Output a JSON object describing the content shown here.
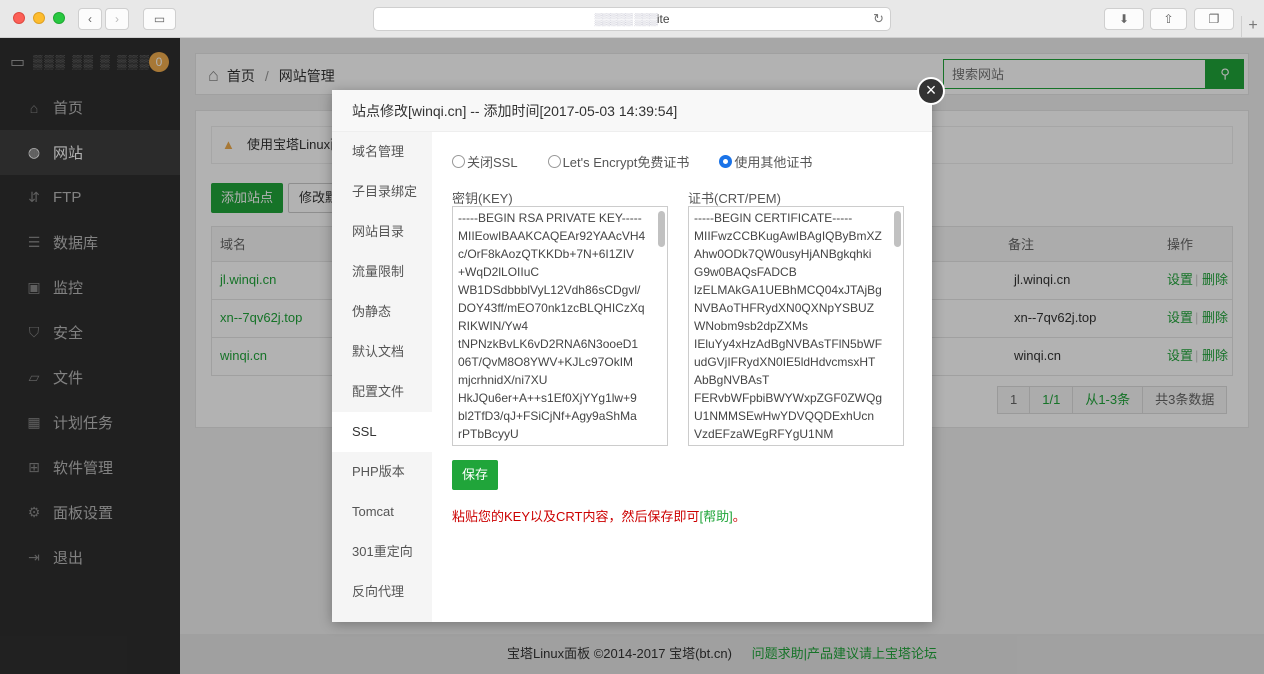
{
  "browser": {
    "url": "ite",
    "url_blur": "▒▒▒▒▒  ▒▒▒"
  },
  "sidebar": {
    "host": "▒▒▒ ▒▒ ▒ ▒▒▒",
    "badge": "0",
    "items": [
      {
        "label": "首页",
        "icon": "home-icon"
      },
      {
        "label": "网站",
        "icon": "globe-icon"
      },
      {
        "label": "FTP",
        "icon": "ftp-icon"
      },
      {
        "label": "数据库",
        "icon": "database-icon"
      },
      {
        "label": "监控",
        "icon": "monitor-icon"
      },
      {
        "label": "安全",
        "icon": "shield-icon"
      },
      {
        "label": "文件",
        "icon": "folder-icon"
      },
      {
        "label": "计划任务",
        "icon": "calendar-icon"
      },
      {
        "label": "软件管理",
        "icon": "apps-icon"
      },
      {
        "label": "面板设置",
        "icon": "gear-icon"
      },
      {
        "label": "退出",
        "icon": "logout-icon"
      }
    ]
  },
  "header": {
    "breadcrumb_home": "首页",
    "breadcrumb_sep": "/",
    "breadcrumb_current": "网站管理",
    "search_placeholder": "搜索网站"
  },
  "content": {
    "alert_text": "使用宝塔Linux面",
    "add_site_button": "添加站点",
    "modify_button": "修改默",
    "columns": {
      "domain": "域名",
      "remark": "备注",
      "actions": "操作"
    },
    "rows": [
      {
        "domain": "jl.winqi.cn",
        "remark": "jl.winqi.cn",
        "settings": "设置",
        "delete": "删除"
      },
      {
        "domain": "xn--7qv62j.top",
        "remark": "xn--7qv62j.top",
        "settings": "设置",
        "delete": "删除"
      },
      {
        "domain": "winqi.cn",
        "remark": "winqi.cn",
        "settings": "设置",
        "delete": "删除"
      }
    ],
    "pager": {
      "page": "1",
      "pages": "1/1",
      "range": "从1-3条",
      "total": "共3条数据"
    }
  },
  "footer": {
    "copyright": "宝塔Linux面板 ©2014-2017 宝塔(bt.cn)",
    "links": "问题求助|产品建议请上宝塔论坛"
  },
  "modal": {
    "title": "站点修改[winqi.cn] -- 添加时间[2017-05-03 14:39:54]",
    "close": "×",
    "tabs": [
      "域名管理",
      "子目录绑定",
      "网站目录",
      "流量限制",
      "伪静态",
      "默认文档",
      "配置文件",
      "SSL",
      "PHP版本",
      "Tomcat",
      "301重定向",
      "反向代理"
    ],
    "active_tab": "SSL",
    "radios": [
      {
        "label": "关闭SSL",
        "checked": false
      },
      {
        "label": "Let's Encrypt免费证书",
        "checked": false
      },
      {
        "label": "使用其他证书",
        "checked": true
      }
    ],
    "key_label": "密钥(KEY)",
    "cert_label": "证书(CRT/PEM)",
    "key_lines": [
      "-----BEGIN RSA PRIVATE KEY-----",
      "MIIEowIBAAKCAQEAr92YAAcVH4",
      "c/OrF8kAozQTKKDb+7N+6I1ZIV",
      "+WqD2lLOIIuC",
      "WB1DSdbbblVyL12Vdh86sCDgvl/",
      "DOY43ff/mEO70nk1zcBLQHICzXq",
      "RIKWIN/Yw4",
      "tNPNzkBvLK6vD2RNA6N3ooeD1",
      "06T/QvM8O8YWV+KJLc97OkIM",
      "mjcrhnidX/ni7XU",
      "HkJQu6er+A++s1Ef0XjYYg1lw+9",
      "bl2TfD3/qJ+FSiCjNf+Agy9aShMa",
      "rPTbBcyyU"
    ],
    "cert_lines": [
      "-----BEGIN CERTIFICATE-----",
      "MIIFwzCCBKugAwIBAgIQByBmXZ",
      "Ahw0ODk7QW0usyHjANBgkqhki",
      "G9w0BAQsFADCB",
      "lzELMAkGA1UEBhMCQ04xJTAjBg",
      "NVBAoTHFRydXN0QXNpYSBUZ",
      "WNobm9sb2dpZXMs",
      "IEluYy4xHzAdBgNVBAsTFlN5bWF",
      "udGVjIFRydXN0IE5ldHdvcmsxHT",
      "AbBgNVBAsT",
      "FERvbWFpbiBWYWxpZGF0ZWQg",
      "U1NMMSEwHwYDVQQDExhUcn",
      "VzdEFzaWEgRFYgU1NM"
    ],
    "save_button": "保存",
    "hint_text": "粘贴您的KEY以及CRT内容，然后保存即可",
    "hint_help": "[帮助]",
    "hint_end": "。"
  }
}
